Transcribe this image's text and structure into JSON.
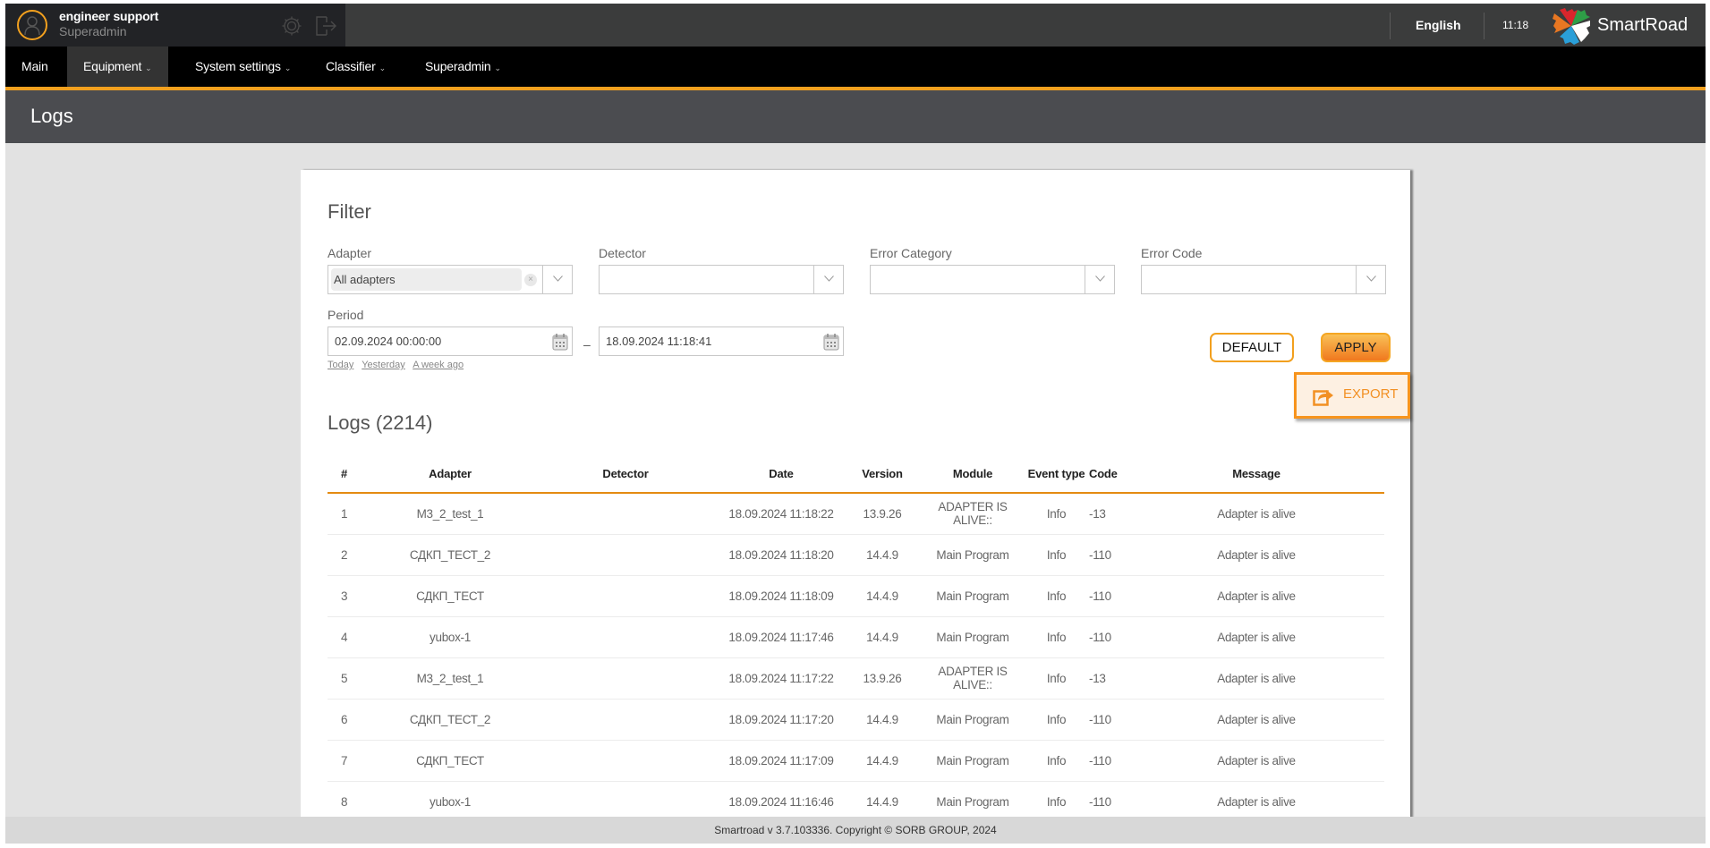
{
  "header": {
    "user_name": "engineer support",
    "user_role": "Superadmin",
    "language": "English",
    "time": "11:18",
    "brand": "SmartRoad",
    "icons": {
      "avatar": "user-circle-icon",
      "settings": "gear-icon",
      "logout": "logout-icon",
      "logo": "smartroad-logo-icon"
    }
  },
  "nav": {
    "items": [
      {
        "label": "Main",
        "has_dropdown": false,
        "active": false
      },
      {
        "label": "Equipment",
        "has_dropdown": true,
        "active": true
      },
      {
        "label": "System settings",
        "has_dropdown": true,
        "active": false
      },
      {
        "label": "Classifier",
        "has_dropdown": true,
        "active": false
      },
      {
        "label": "Superadmin",
        "has_dropdown": true,
        "active": false
      }
    ],
    "chevron": "⌄"
  },
  "page": {
    "title": "Logs"
  },
  "filter": {
    "title": "Filter",
    "adapter": {
      "label": "Adapter",
      "value": "All adapters",
      "clear": "×"
    },
    "detector": {
      "label": "Detector",
      "value": ""
    },
    "error_category": {
      "label": "Error Category",
      "value": ""
    },
    "error_code": {
      "label": "Error Code",
      "value": ""
    },
    "period": {
      "label": "Period",
      "from": "02.09.2024 00:00:00",
      "separator": "–",
      "to": "18.09.2024 11:18:41",
      "quick_links": [
        "Today",
        "Yesterday",
        "A week ago"
      ]
    },
    "default_label": "DEFAULT",
    "apply_label": "APPLY",
    "export_label": "EXPORT"
  },
  "logs": {
    "title": "Logs (2214)",
    "columns": [
      "#",
      "Adapter",
      "Detector",
      "Date",
      "Version",
      "Module",
      "Event type",
      "Code",
      "Message"
    ],
    "rows": [
      [
        "1",
        "M3_2_test_1",
        "",
        "18.09.2024 11:18:22",
        "13.9.26",
        "ADAPTER IS ALIVE::",
        "Info",
        "-13",
        "Adapter is alive"
      ],
      [
        "2",
        "СДКП_ТЕСТ_2",
        "",
        "18.09.2024 11:18:20",
        "14.4.9",
        "Main Program",
        "Info",
        "-110",
        "Adapter is alive"
      ],
      [
        "3",
        "СДКП_ТЕСТ",
        "",
        "18.09.2024 11:18:09",
        "14.4.9",
        "Main Program",
        "Info",
        "-110",
        "Adapter is alive"
      ],
      [
        "4",
        "yubox-1",
        "",
        "18.09.2024 11:17:46",
        "14.4.9",
        "Main Program",
        "Info",
        "-110",
        "Adapter is alive"
      ],
      [
        "5",
        "M3_2_test_1",
        "",
        "18.09.2024 11:17:22",
        "13.9.26",
        "ADAPTER IS ALIVE::",
        "Info",
        "-13",
        "Adapter is alive"
      ],
      [
        "6",
        "СДКП_ТЕСТ_2",
        "",
        "18.09.2024 11:17:20",
        "14.4.9",
        "Main Program",
        "Info",
        "-110",
        "Adapter is alive"
      ],
      [
        "7",
        "СДКП_ТЕСТ",
        "",
        "18.09.2024 11:17:09",
        "14.4.9",
        "Main Program",
        "Info",
        "-110",
        "Adapter is alive"
      ],
      [
        "8",
        "yubox-1",
        "",
        "18.09.2024 11:16:46",
        "14.4.9",
        "Main Program",
        "Info",
        "-110",
        "Adapter is alive"
      ]
    ]
  },
  "footer": {
    "text": "Smartroad v 3.7.103336. Copyright © SORB GROUP, 2024"
  },
  "colors": {
    "accent": "#f2a01e",
    "table_rule": "#e48b12",
    "export_text": "#f29023"
  }
}
